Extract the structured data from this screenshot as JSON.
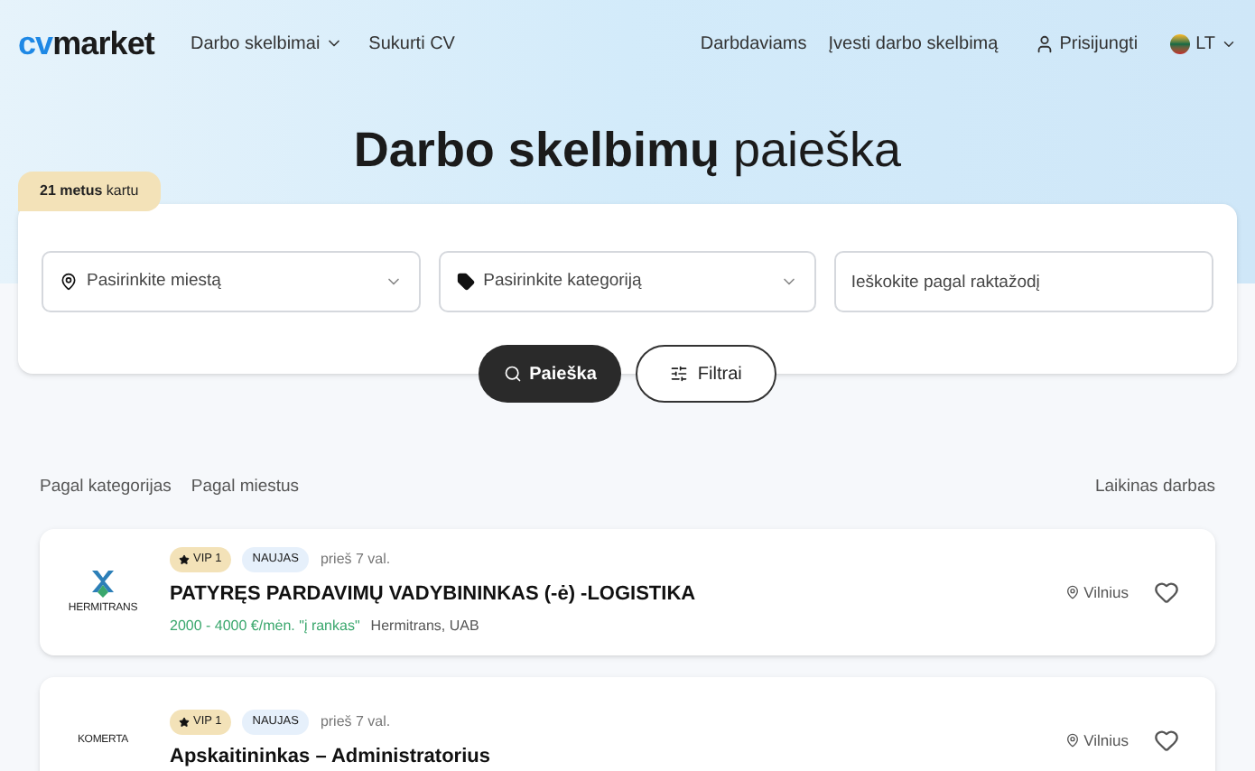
{
  "header": {
    "logo": {
      "part1": "cv",
      "part2": "market"
    },
    "nav": [
      {
        "label": "Darbo skelbimai",
        "dropdown": true
      },
      {
        "label": "Sukurti CV",
        "dropdown": false
      }
    ],
    "right": [
      "Darbdaviams",
      "Įvesti darbo skelbimą"
    ],
    "login": "Prisijungti",
    "language": "LT"
  },
  "title": {
    "bold": "Darbo skelbimų",
    "light": "paieška"
  },
  "badge": {
    "bold": "21 metus",
    "light": "kartu"
  },
  "search": {
    "city": {
      "placeholder": "Pasirinkite miestą"
    },
    "category": {
      "placeholder": "Pasirinkite kategoriją"
    },
    "keyword": {
      "placeholder": "Ieškokite pagal raktažodį"
    },
    "search_button": "Paieška",
    "filter_button": "Filtrai"
  },
  "links": {
    "left": [
      "Pagal kategorijas",
      "Pagal miestus"
    ],
    "right": "Laikinas darbas"
  },
  "jobs": [
    {
      "logo": "HERMITRANS",
      "vip": "VIP 1",
      "new": "NAUJAS",
      "time": "prieš 7 val.",
      "title": "PATYRĘS PARDAVIMŲ VADYBININKAS (-ė) -LOGISTIKA",
      "salary": "2000 - 4000 €/mėn. \"į rankas\"",
      "company": "Hermitrans, UAB",
      "city": "Vilnius",
      "favorite": false
    },
    {
      "logo": "KOMERTA",
      "vip": "VIP 1",
      "new": "NAUJAS",
      "time": "prieš 7 val.",
      "title": "Apskaitininkas – Administratorius",
      "city": "Vilnius",
      "favorite": false
    }
  ]
}
